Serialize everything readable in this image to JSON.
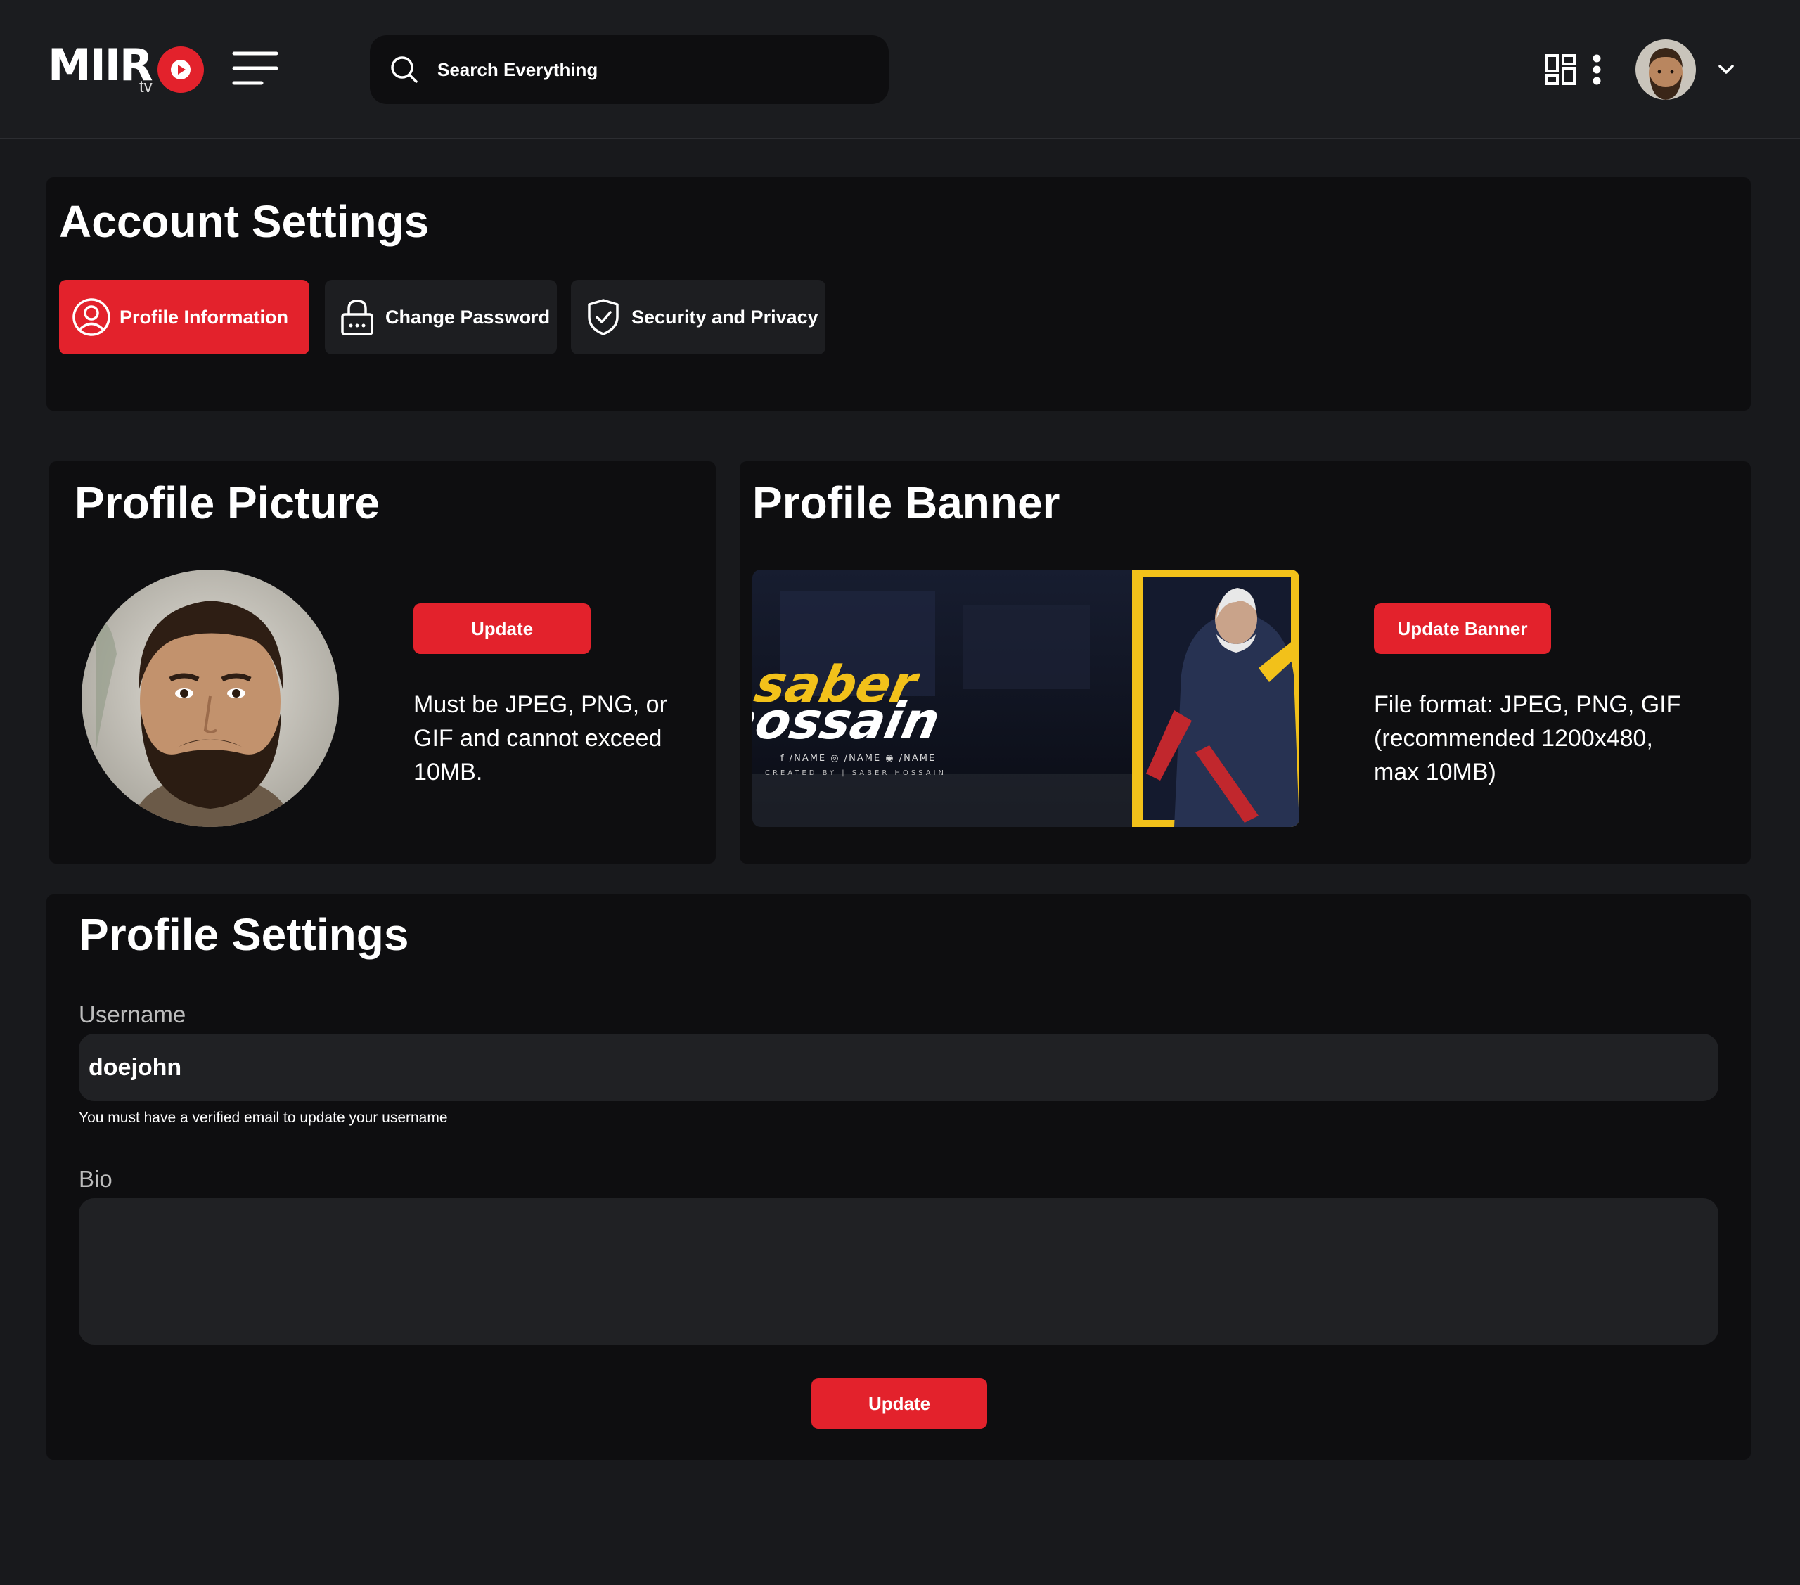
{
  "header": {
    "logo_text": "MIIR",
    "logo_sub": "tv",
    "search_placeholder": "Search Everything",
    "icons": [
      "hamburger-menu-icon",
      "search-icon",
      "grid-apps-icon",
      "kebab-menu-icon",
      "chevron-down-icon"
    ]
  },
  "account_settings": {
    "title": "Account Settings",
    "tabs": [
      {
        "label": "Profile Information",
        "icon": "user-circle-icon",
        "active": true
      },
      {
        "label": "Change Password",
        "icon": "lock-icon",
        "active": false
      },
      {
        "label": "Security and Privacy",
        "icon": "shield-check-icon",
        "active": false
      }
    ]
  },
  "profile_picture": {
    "title": "Profile Picture",
    "button": "Update",
    "note": "Must be JPEG, PNG, or GIF and cannot exceed 10MB."
  },
  "profile_banner": {
    "title": "Profile Banner",
    "button": "Update Banner",
    "note": "File format: JPEG, PNG, GIF (recommended 1200x480, max 10MB)",
    "banner_text": {
      "line1": "saber",
      "line2": "hossain",
      "socials": "f /NAME   ◎ /NAME   ◉ /NAME",
      "credit": "CREATED BY | SABER HOSSAIN"
    }
  },
  "profile_settings": {
    "title": "Profile Settings",
    "username_label": "Username",
    "username_value": "doejohn",
    "username_hint": "You must have a verified email to update your username",
    "bio_label": "Bio",
    "bio_value": "",
    "submit": "Update"
  },
  "colors": {
    "accent": "#e3222c",
    "background": "#18191c",
    "card": "#0e0e10",
    "input": "#202124",
    "banner_yellow": "#f2c11a"
  }
}
